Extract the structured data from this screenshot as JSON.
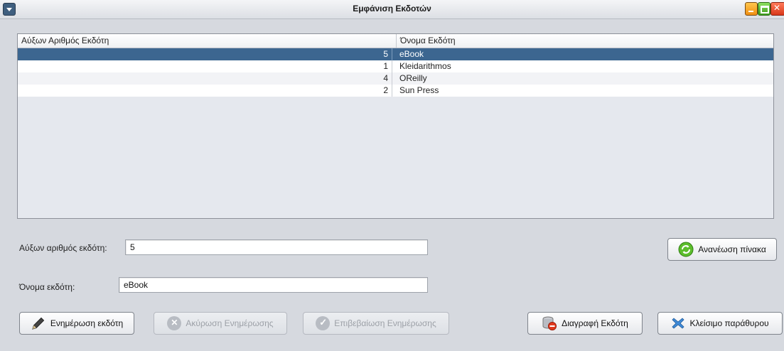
{
  "window": {
    "title": "Εμφάνιση Εκδοτών",
    "controls": [
      "menu-icon",
      "minimize-icon",
      "maximize-icon",
      "close-icon"
    ]
  },
  "table": {
    "columns": [
      "Αύξων Αριθμός Εκδότη",
      "Όνομα Εκδότη"
    ],
    "rows": [
      {
        "id": "5",
        "name": "eBook",
        "selected": true
      },
      {
        "id": "1",
        "name": "Kleidarithmos",
        "selected": false
      },
      {
        "id": "4",
        "name": "OReilly",
        "selected": false
      },
      {
        "id": "2",
        "name": "Sun Press",
        "selected": false
      }
    ]
  },
  "form": {
    "id_label": "Αύξων αριθμός εκδότη:",
    "id_value": "5",
    "name_label": "Όνομα εκδότη:",
    "name_value": "eBook"
  },
  "buttons": {
    "update": "Ενημέρωση εκδότη",
    "cancel_update": "Ακύρωση Ενημέρωσης",
    "confirm_update": "Επιβεβαίωση Ενημέρωσης",
    "delete": "Διαγραφή Εκδότη",
    "close": "Κλείσιμο παράθυρου",
    "refresh": "Ανανέωση πίνακα"
  },
  "colors": {
    "selection": "#3c6690",
    "background": "#d6d9df"
  }
}
